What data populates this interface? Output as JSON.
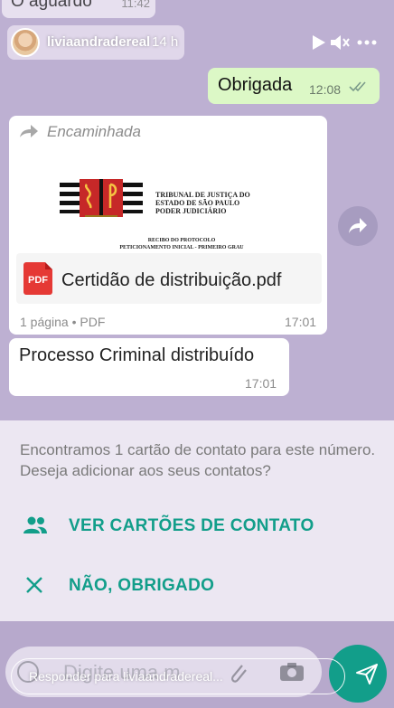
{
  "story": {
    "username": "liviaandradereal",
    "time_ago": "14 h",
    "reply_placeholder": "Responder para liviaandradereal..."
  },
  "chat": {
    "partial_top": {
      "text": "O aguardo",
      "time": "11:42"
    },
    "sent_message": {
      "text": "Obrigada",
      "time": "12:08"
    },
    "document_message": {
      "forwarded_label": "Encaminhada",
      "preview": {
        "header_lines": [
          "TRIBUNAL DE JUSTIÇA DO",
          "ESTADO DE SÃO PAULO",
          "PODER JUDICIÁRIO"
        ],
        "receipt_lines": [
          "RECIBO DO PROTOCOLO",
          "PETICIONAMENTO INICIAL - PRIMEIRO GRAU"
        ]
      },
      "file_type_badge": "PDF",
      "file_name": "Certidão de distribuição.pdf",
      "meta": "1 página • PDF",
      "time": "17:01"
    },
    "text_message": {
      "text": "Processo Criminal distribuído",
      "time": "17:01"
    },
    "placeholder_faded": "Digite uma m"
  },
  "contact_panel": {
    "message": "Encontramos 1 cartão de contato para este número. Deseja adicionar aos seus contatos?",
    "view_contacts_label": "VER CARTÕES DE CONTATO",
    "dismiss_label": "NÃO, OBRIGADO"
  },
  "colors": {
    "accent_teal": "#129e8a",
    "sent_bubble": "#dcf8c6",
    "chat_background": "#bdb0d2",
    "pdf_red": "#e53935"
  }
}
